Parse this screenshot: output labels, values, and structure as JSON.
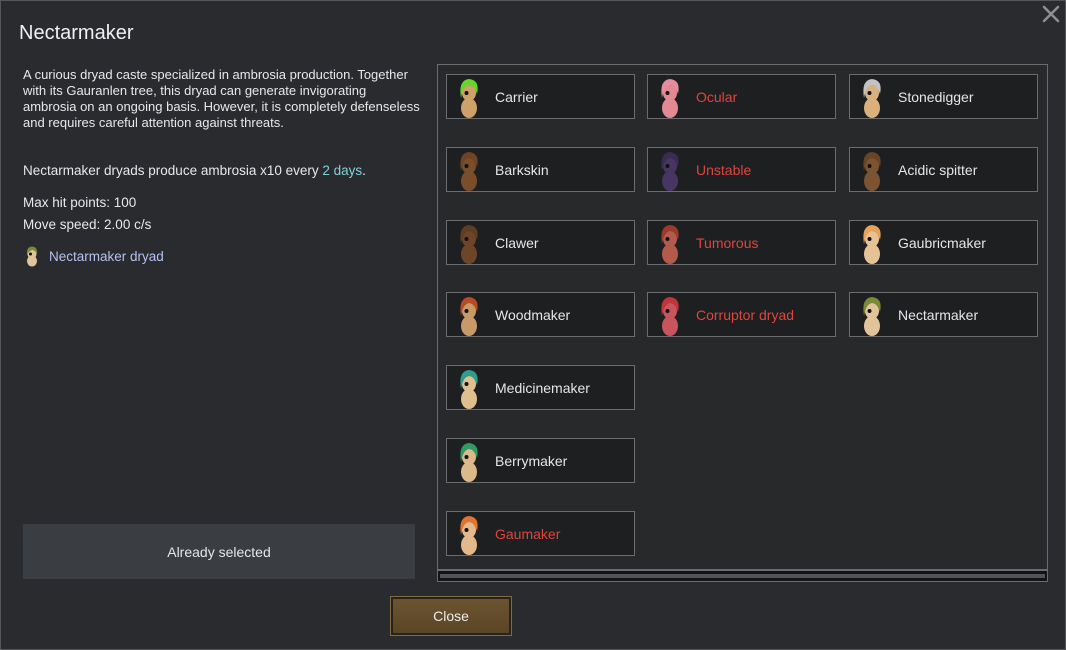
{
  "dialog": {
    "title": "Nectarmaker",
    "description": "A curious dryad caste specialized in ambrosia production. Together with its Gauranlen tree, this dryad can generate invigorating ambrosia on an ongoing basis. However, it is completely defenseless and requires careful attention against threats.",
    "production_prefix": "Nectarmaker dryads produce ambrosia x10 every ",
    "production_interval": "2 days",
    "production_suffix": ".",
    "max_hit_points": "Max hit points: 100",
    "move_speed": "Move speed: 2.00 c/s",
    "kind_link": "Nectarmaker dryad",
    "already_selected": "Already selected",
    "close_label": "Close",
    "close_icon": "close-x-icon"
  },
  "colors": {
    "locked_text": "#e0443f",
    "highlight_text": "#7ed3db",
    "link_text": "#b5c2ee",
    "close_button": "#5e4a2b"
  },
  "castes": [
    {
      "label": "Carrier",
      "locked": false,
      "hair": "#65d62a",
      "body": "#cfa069"
    },
    {
      "label": "Ocular",
      "locked": true,
      "hair": "#e58c9f",
      "body": "#e38994"
    },
    {
      "label": "Stonedigger",
      "locked": false,
      "hair": "#c3c3c3",
      "body": "#d9b07e"
    },
    {
      "label": "Barkskin",
      "locked": false,
      "hair": "#6e4424",
      "body": "#7a4e2b"
    },
    {
      "label": "Unstable",
      "locked": true,
      "hair": "#3b2a52",
      "body": "#473661"
    },
    {
      "label": "Acidic spitter",
      "locked": false,
      "hair": "#6a4425",
      "body": "#7d5432"
    },
    {
      "label": "Clawer",
      "locked": false,
      "hair": "#5e3d22",
      "body": "#6d4528"
    },
    {
      "label": "Tumorous",
      "locked": true,
      "hair": "#9a3b2c",
      "body": "#b35a4c"
    },
    {
      "label": "Gaubricmaker",
      "locked": false,
      "hair": "#e8a35a",
      "body": "#e7c294"
    },
    {
      "label": "Woodmaker",
      "locked": false,
      "hair": "#b84a25",
      "body": "#c79a67"
    },
    {
      "label": "Corruptor dryad",
      "locked": true,
      "hair": "#c0353a",
      "body": "#c8555e"
    },
    {
      "label": "Nectarmaker",
      "locked": false,
      "hair": "#7a8a39",
      "body": "#e2c49a"
    },
    {
      "label": "Medicinemaker",
      "locked": false,
      "hair": "#2f9c8c",
      "body": "#e0bf8f"
    },
    {
      "label": "Berrymaker",
      "locked": false,
      "hair": "#2d9b63",
      "body": "#dcb98b"
    },
    {
      "label": "Gaumaker",
      "locked": true,
      "hair": "#e0752f",
      "body": "#e3b88a"
    }
  ]
}
